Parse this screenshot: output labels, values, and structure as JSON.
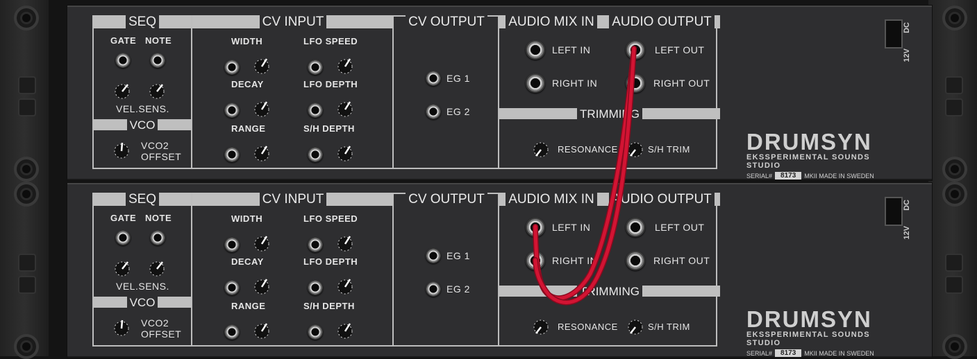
{
  "sections": {
    "seq": "SEQ",
    "cv_input": "CV INPUT",
    "cv_output": "CV OUTPUT",
    "audio_mix_in": "AUDIO MIX IN",
    "audio_output": "AUDIO OUTPUT",
    "vco": "VCO",
    "trimming": "TRIMMING"
  },
  "labels": {
    "gate": "GATE",
    "note": "NOTE",
    "vel_sens": "VEL.SENS.",
    "vco2_offset_1": "VCO2",
    "vco2_offset_2": "OFFSET",
    "width": "WIDTH",
    "decay": "DECAY",
    "range": "RANGE",
    "lfo_speed": "LFO SPEED",
    "lfo_depth": "LFO DEPTH",
    "sh_depth": "S/H DEPTH",
    "eg1": "EG 1",
    "eg2": "EG 2",
    "left_in": "LEFT IN",
    "right_in": "RIGHT IN",
    "left_out": "LEFT OUT",
    "right_out": "RIGHT OUT",
    "resonance": "RESONANCE",
    "sh_trim": "S/H TRIM"
  },
  "brand": {
    "name": "DRUMSYN",
    "studio": "EKSSPERIMENTAL SOUNDS STUDIO",
    "serial_label": "SERIAL#",
    "serial": "8173",
    "made_in": "MKII MADE IN SWEDEN"
  },
  "power": {
    "dc": "DC",
    "voltage": "12V"
  },
  "cable": {
    "color": "#c8102e",
    "from": "unit1.left_out",
    "to": "unit2.left_in + unit2.right_in"
  }
}
